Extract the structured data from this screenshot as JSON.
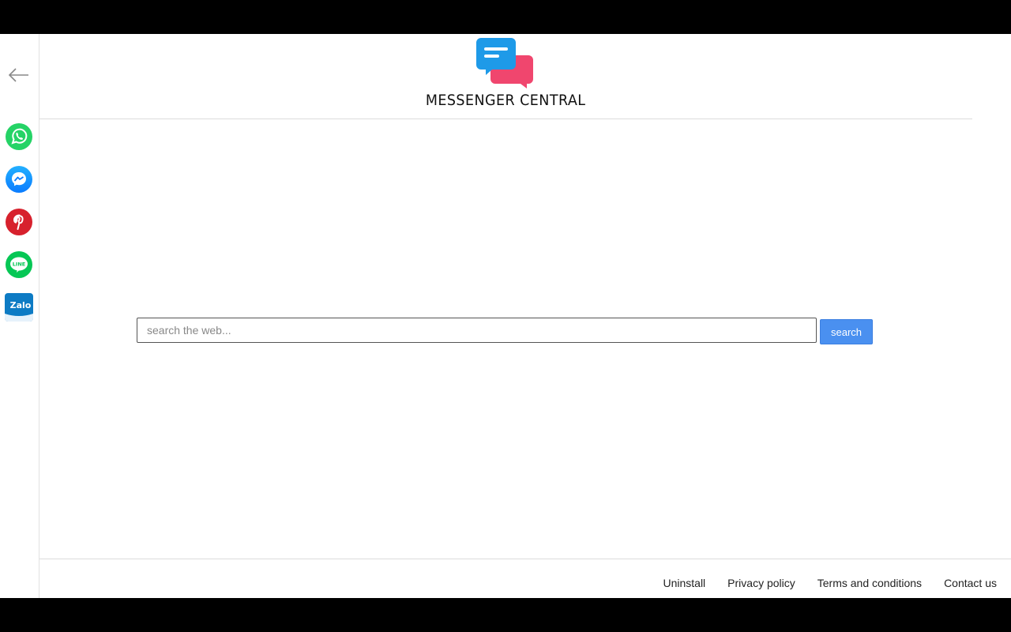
{
  "brand": {
    "name": "MESSENGER CENTRAL",
    "colors": {
      "blue": "#1e9ae8",
      "pink": "#f0466e"
    }
  },
  "sidebar": {
    "back_icon": "arrow-left-icon",
    "apps": [
      {
        "name": "whatsapp",
        "icon": "whatsapp-icon",
        "color": "#25d366"
      },
      {
        "name": "messenger",
        "icon": "messenger-icon",
        "color": "#1a8cff"
      },
      {
        "name": "pinterest",
        "icon": "pinterest-icon",
        "color": "#d7212d"
      },
      {
        "name": "line",
        "icon": "line-icon",
        "color": "#06c755",
        "label": "LINE"
      },
      {
        "name": "zalo",
        "icon": "zalo-icon",
        "color": "#0068ff",
        "label": "Zalo"
      }
    ]
  },
  "search": {
    "placeholder": "search the web...",
    "value": "",
    "button_label": "search",
    "button_color": "#4a90f0"
  },
  "footer": {
    "links": [
      "Uninstall",
      "Privacy policy",
      "Terms and conditions",
      "Contact us"
    ]
  }
}
